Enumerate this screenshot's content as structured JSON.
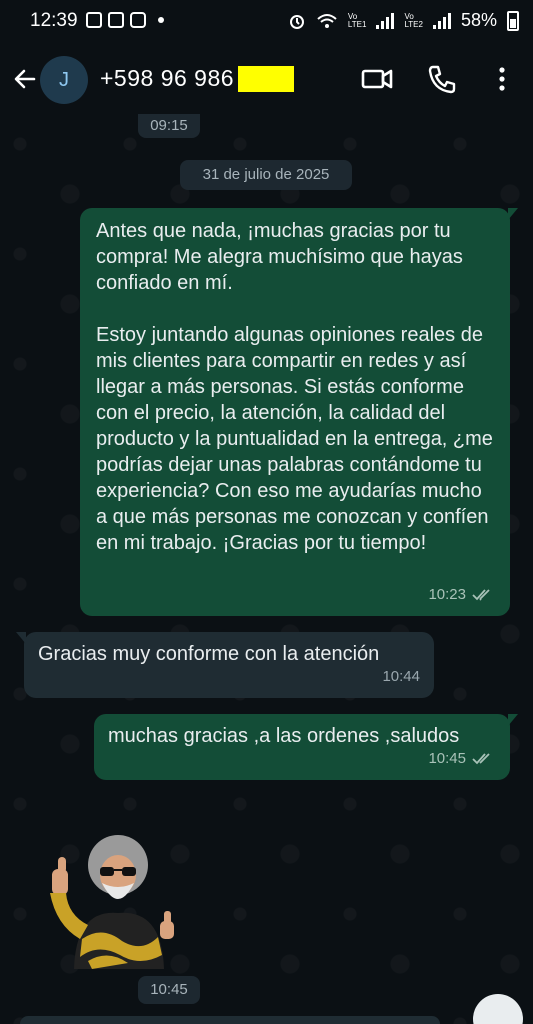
{
  "status_bar": {
    "time": "12:39",
    "battery": "58%",
    "lte1": "LTE1",
    "lte2": "LTE2"
  },
  "header": {
    "avatar_initial": "J",
    "contact_name": "+598 96 986",
    "icons": [
      "back-arrow-icon",
      "video-call-icon",
      "phone-icon",
      "more-vert-icon"
    ]
  },
  "chat": {
    "top_time": "09:15",
    "date_divider": "31 de julio de 2025",
    "messages": [
      {
        "direction": "out",
        "text": "Antes que nada, ¡muchas gracias por tu compra! Me alegra muchísimo que hayas confiado en mí.\n\nEstoy juntando algunas opiniones reales de mis clientes para compartir en redes y así llegar a más personas. Si estás conforme con el precio, la atención, la calidad del producto y la puntualidad en la entrega, ¿me podrías dejar unas palabras contándome tu experiencia? Con eso me ayudarías  mucho a que más personas me conozcan y confíen en mi trabajo. ¡Gracias por tu tiempo!",
        "time": "10:23",
        "status": "read"
      },
      {
        "direction": "in",
        "text": "Gracias muy conforme con la atención",
        "time": "10:44"
      },
      {
        "direction": "out",
        "text": "muchas gracias ,a las ordenes ,saludos",
        "time": "10:45",
        "status": "read"
      }
    ],
    "sticker_time": "10:45"
  },
  "colors": {
    "background": "#0b1014",
    "outgoing_bubble": "#134d37",
    "incoming_bubble": "#1f2c33",
    "redaction": "#ffff00"
  }
}
